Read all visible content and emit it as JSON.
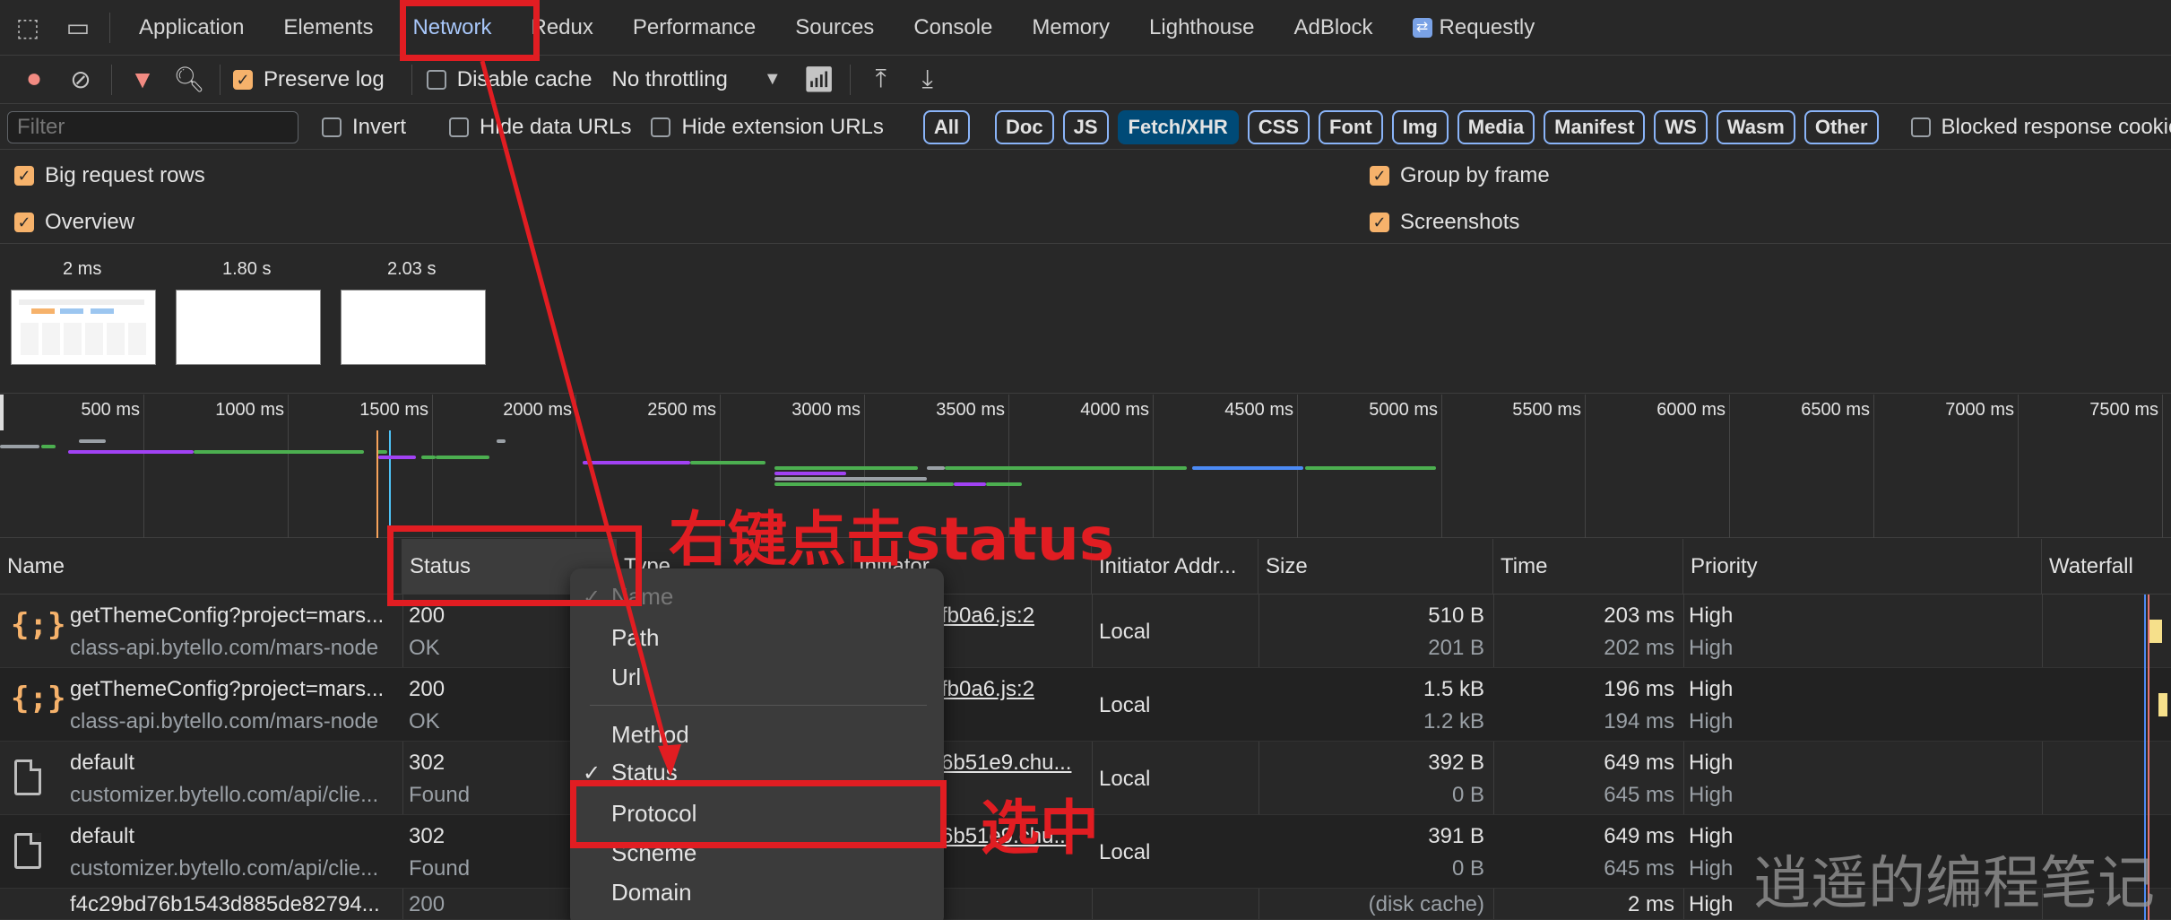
{
  "tabs": [
    {
      "label": "Application",
      "active": false
    },
    {
      "label": "Elements",
      "active": false
    },
    {
      "label": "Network",
      "active": true
    },
    {
      "label": "Redux",
      "active": false
    },
    {
      "label": "Performance",
      "active": false
    },
    {
      "label": "Sources",
      "active": false
    },
    {
      "label": "Console",
      "active": false
    },
    {
      "label": "Memory",
      "active": false
    },
    {
      "label": "Lighthouse",
      "active": false
    },
    {
      "label": "AdBlock",
      "active": false
    },
    {
      "label": "Requestly",
      "active": false
    }
  ],
  "toolbar": {
    "preserve_log": "Preserve log",
    "disable_cache": "Disable cache",
    "throttling": "No throttling"
  },
  "filterbar": {
    "filter_placeholder": "Filter",
    "invert": "Invert",
    "hide_data_urls": "Hide data URLs",
    "hide_extension_urls": "Hide extension URLs",
    "chips": [
      "All",
      "Doc",
      "JS",
      "Fetch/XHR",
      "CSS",
      "Font",
      "Img",
      "Media",
      "Manifest",
      "WS",
      "Wasm",
      "Other"
    ],
    "active_chip": "Fetch/XHR",
    "blocked_cookies": "Blocked response cookies"
  },
  "settings": {
    "big_request_rows": "Big request rows",
    "overview": "Overview",
    "group_by_frame": "Group by frame",
    "screenshots": "Screenshots"
  },
  "screenshots": [
    "2 ms",
    "1.80 s",
    "2.03 s"
  ],
  "overview_ticks": [
    "500 ms",
    "1000 ms",
    "1500 ms",
    "2000 ms",
    "2500 ms",
    "3000 ms",
    "3500 ms",
    "4000 ms",
    "4500 ms",
    "5000 ms",
    "5500 ms",
    "6000 ms",
    "6500 ms",
    "7000 ms",
    "7500 ms"
  ],
  "columns": [
    "Name",
    "Status",
    "Type",
    "Initiator",
    "Initiator Addr...",
    "Size",
    "Time",
    "Priority",
    "Waterfall"
  ],
  "rows": [
    {
      "name": "getThemeConfig?project=mars...",
      "domain": "class-api.bytello.com/mars-node",
      "status": "200",
      "status_text": "OK",
      "initiator": "fb0a6.js:2",
      "addr": "Local",
      "size": "510 B",
      "size2": "201 B",
      "time": "203 ms",
      "time2": "202 ms",
      "priority": "High",
      "priority2": "High",
      "icon": "xhr-braces-icon"
    },
    {
      "name": "getThemeConfig?project=mars...",
      "domain": "class-api.bytello.com/mars-node",
      "status": "200",
      "status_text": "OK",
      "initiator": "fb0a6.js:2",
      "addr": "Local",
      "size": "1.5 kB",
      "size2": "1.2 kB",
      "time": "196 ms",
      "time2": "194 ms",
      "priority": "High",
      "priority2": "High",
      "icon": "xhr-braces-icon"
    },
    {
      "name": "default",
      "domain": "customizer.bytello.com/api/clie...",
      "status": "302",
      "status_text": "Found",
      "initiator": "6b51e9.chu...",
      "addr": "Local",
      "size": "392 B",
      "size2": "0 B",
      "time": "649 ms",
      "time2": "645 ms",
      "priority": "High",
      "priority2": "High",
      "icon": "document-icon"
    },
    {
      "name": "default",
      "domain": "customizer.bytello.com/api/clie...",
      "status": "302",
      "status_text": "Found",
      "initiator": "6b51e9.chu...",
      "addr": "Local",
      "size": "391 B",
      "size2": "0 B",
      "time": "649 ms",
      "time2": "645 ms",
      "priority": "High",
      "priority2": "High",
      "icon": "document-icon"
    },
    {
      "name": "f4c29bd76b1543d885de82794...",
      "domain": "",
      "status": "200",
      "status_text": "",
      "initiator": "",
      "addr": "",
      "size": "(disk cache)",
      "size2": "",
      "time": "2 ms",
      "time2": "",
      "priority": "High",
      "priority2": "",
      "icon": "document-icon"
    }
  ],
  "context_menu": {
    "items": [
      {
        "label": "Name",
        "checked": true,
        "dim": true
      },
      {
        "label": "Path",
        "checked": false
      },
      {
        "label": "Url",
        "checked": false
      },
      {
        "label": "Method",
        "checked": false
      },
      {
        "label": "Status",
        "checked": true
      },
      {
        "label": "Protocol",
        "checked": false
      },
      {
        "label": "Scheme",
        "checked": false
      },
      {
        "label": "Domain",
        "checked": false
      }
    ]
  },
  "annotations": {
    "right_click": "右键点击status",
    "select": "选中"
  },
  "watermark": "逍遥的编程笔记",
  "colors": {
    "annotation_red": "#e11d22",
    "active_tab": "#a8c7fa",
    "checkbox": "#f6b26b",
    "chip_active": "#004a77"
  }
}
